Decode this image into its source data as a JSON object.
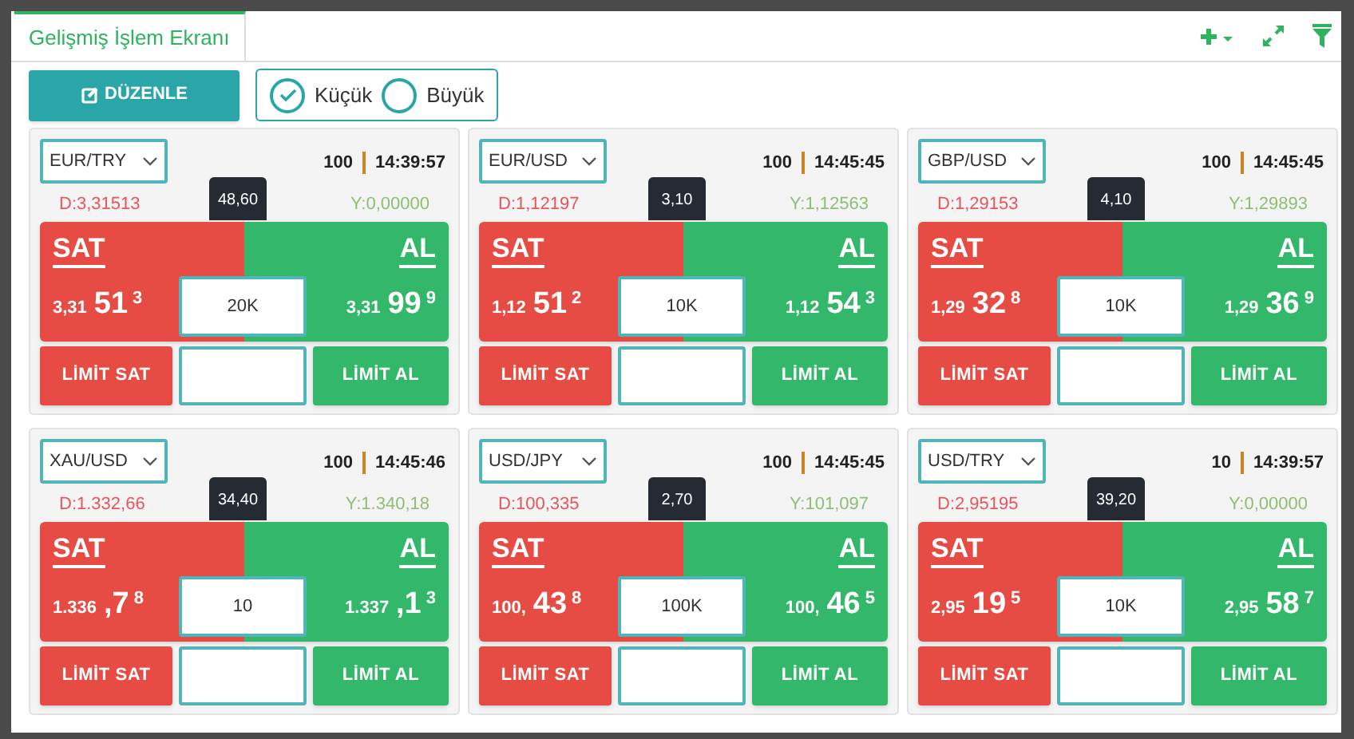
{
  "tab": {
    "label": "Gelişmiş İşlem Ekranı",
    "selected": true
  },
  "toolbar": {
    "edit_button": "DÜZENLE",
    "size_options": [
      {
        "label": "Küçük",
        "selected": true
      },
      {
        "label": "Büyük",
        "selected": false
      }
    ]
  },
  "cards": [
    {
      "symbol": "EUR/TRY",
      "quantity": "100",
      "time": "14:39:57",
      "low": "D:3,31513",
      "spread": "48,60",
      "high": "Y:0,00000",
      "sell_label": "SAT",
      "sell": {
        "prefix": "3,31",
        "big": "51",
        "pip": "3"
      },
      "buy_label": "AL",
      "buy": {
        "prefix": "3,31",
        "big": "99",
        "pip": "9"
      },
      "amount": "20K",
      "limit_sell": "LİMİT SAT",
      "limit_buy": "LİMİT AL"
    },
    {
      "symbol": "EUR/USD",
      "quantity": "100",
      "time": "14:45:45",
      "low": "D:1,12197",
      "spread": "3,10",
      "high": "Y:1,12563",
      "sell_label": "SAT",
      "sell": {
        "prefix": "1,12",
        "big": "51",
        "pip": "2"
      },
      "buy_label": "AL",
      "buy": {
        "prefix": "1,12",
        "big": "54",
        "pip": "3"
      },
      "amount": "10K",
      "limit_sell": "LİMİT SAT",
      "limit_buy": "LİMİT AL"
    },
    {
      "symbol": "GBP/USD",
      "quantity": "100",
      "time": "14:45:45",
      "low": "D:1,29153",
      "spread": "4,10",
      "high": "Y:1,29893",
      "sell_label": "SAT",
      "sell": {
        "prefix": "1,29",
        "big": "32",
        "pip": "8"
      },
      "buy_label": "AL",
      "buy": {
        "prefix": "1,29",
        "big": "36",
        "pip": "9"
      },
      "amount": "10K",
      "limit_sell": "LİMİT SAT",
      "limit_buy": "LİMİT AL"
    },
    {
      "symbol": "XAU/USD",
      "quantity": "100",
      "time": "14:45:46",
      "low": "D:1.332,66",
      "spread": "34,40",
      "high": "Y:1.340,18",
      "sell_label": "SAT",
      "sell": {
        "prefix": "1.336",
        "big": ",7",
        "pip": "8"
      },
      "buy_label": "AL",
      "buy": {
        "prefix": "1.337",
        "big": ",1",
        "pip": "3"
      },
      "amount": "10",
      "limit_sell": "LİMİT SAT",
      "limit_buy": "LİMİT AL"
    },
    {
      "symbol": "USD/JPY",
      "quantity": "100",
      "time": "14:45:45",
      "low": "D:100,335",
      "spread": "2,70",
      "high": "Y:101,097",
      "sell_label": "SAT",
      "sell": {
        "prefix": "100,",
        "big": "43",
        "pip": "8"
      },
      "buy_label": "AL",
      "buy": {
        "prefix": "100,",
        "big": "46",
        "pip": "5"
      },
      "amount": "100K",
      "limit_sell": "LİMİT SAT",
      "limit_buy": "LİMİT AL"
    },
    {
      "symbol": "USD/TRY",
      "quantity": "10",
      "time": "14:39:57",
      "low": "D:2,95195",
      "spread": "39,20",
      "high": "Y:0,00000",
      "sell_label": "SAT",
      "sell": {
        "prefix": "2,95",
        "big": "19",
        "pip": "5"
      },
      "buy_label": "AL",
      "buy": {
        "prefix": "2,95",
        "big": "58",
        "pip": "7"
      },
      "amount": "10K",
      "limit_sell": "LİMİT SAT",
      "limit_buy": "LİMİT AL"
    }
  ]
}
